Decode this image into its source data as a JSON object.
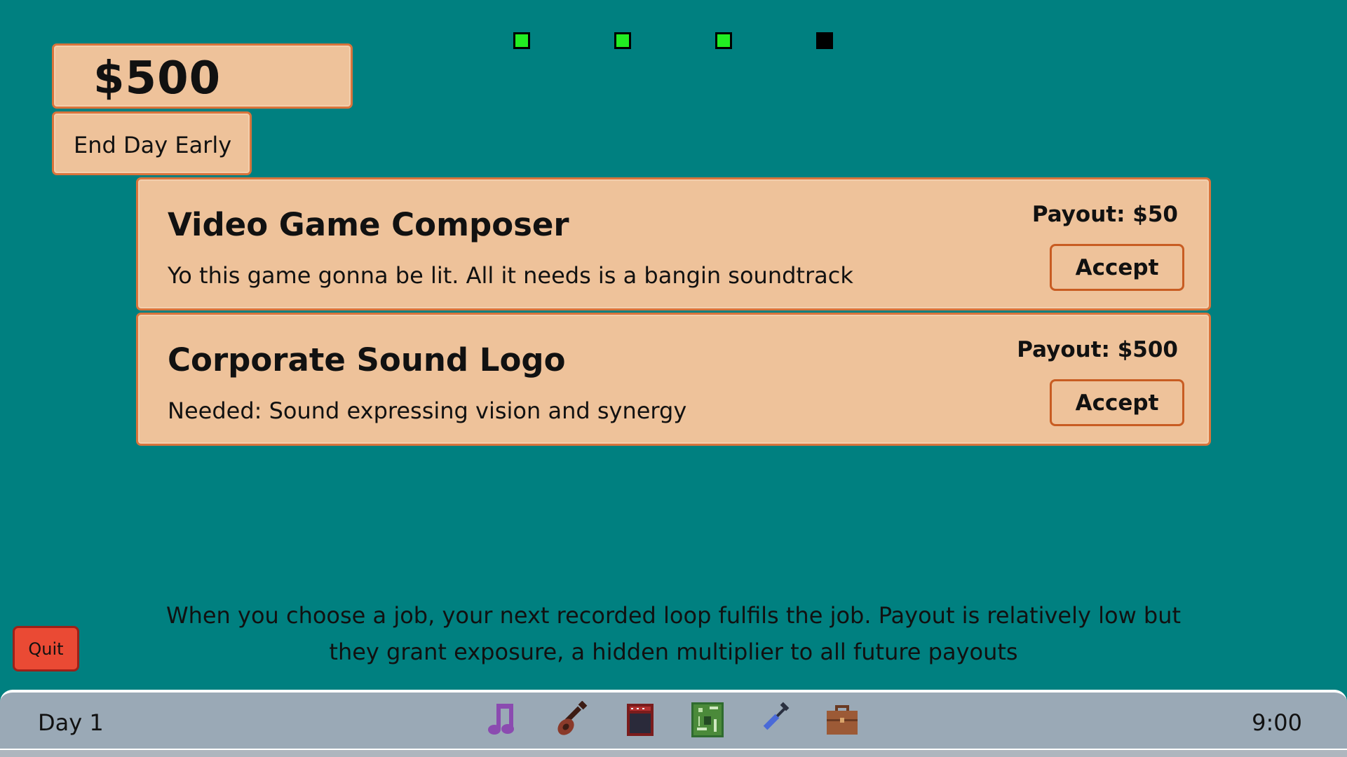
{
  "hud": {
    "money": "$500",
    "end_day_label": "End Day Early",
    "progress_dots": [
      true,
      true,
      true,
      false
    ]
  },
  "jobs": [
    {
      "title": "Video Game Composer",
      "description": "Yo this game gonna be lit. All it needs is a bangin soundtrack",
      "payout": "Payout: $50",
      "accept_label": "Accept"
    },
    {
      "title": "Corporate Sound Logo",
      "description": "Needed: Sound expressing vision and synergy",
      "payout": "Payout: $500",
      "accept_label": "Accept"
    }
  ],
  "hint": "When you choose a job, your next recorded loop fulfils the job. Payout is relatively low but they grant exposure, a hidden multiplier to all future payouts",
  "quit_label": "Quit",
  "taskbar": {
    "day": "Day 1",
    "time": "9:00",
    "icons": [
      "music-note-icon",
      "guitar-icon",
      "amplifier-icon",
      "circuit-board-icon",
      "wrench-icon",
      "briefcase-icon"
    ]
  },
  "colors": {
    "background": "#008080",
    "panel": "#eec29a",
    "panel_border": "#d8743c",
    "quit_button": "#ea4a34",
    "dot_active": "#22ee22",
    "dot_inactive": "#000000",
    "taskbar": "#9aa9b6"
  }
}
